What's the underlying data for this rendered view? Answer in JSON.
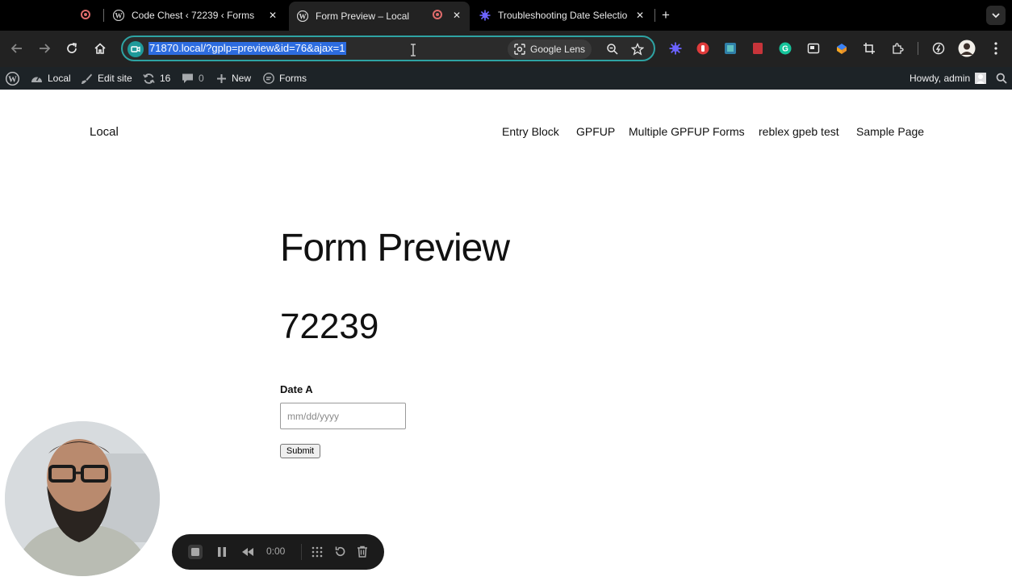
{
  "browser": {
    "tabs": [
      {
        "title": "Code Chest ‹ 72239 ‹ Forms",
        "active": false
      },
      {
        "title": "Form Preview – Local",
        "active": true
      },
      {
        "title": "Troubleshooting Date Selection",
        "active": false
      }
    ],
    "url": "71870.local/?gplp=preview&id=76&ajax=1",
    "lens_label": "Google Lens"
  },
  "adminbar": {
    "site_name": "Local",
    "edit_site": "Edit site",
    "updates_count": "16",
    "comments_count": "0",
    "new_label": "New",
    "forms_label": "Forms",
    "greeting": "Howdy, admin"
  },
  "site": {
    "title": "Local",
    "nav": [
      "Entry Block",
      "GPFUP",
      "Multiple GPFUP Forms",
      "reblex gpeb test",
      "Sample Page"
    ]
  },
  "page": {
    "title": "Form Preview",
    "form_title": "72239",
    "field_label": "Date A",
    "field_placeholder": "mm/dd/yyyy",
    "submit_label": "Submit"
  },
  "recorder": {
    "time": "0:00"
  },
  "colors": {
    "tab_bg": "#000000",
    "toolbar_bg": "#222222",
    "omnibox_border": "#2ea3a3",
    "url_highlight": "#2d6cdf",
    "adminbar_bg": "#1d2327"
  }
}
